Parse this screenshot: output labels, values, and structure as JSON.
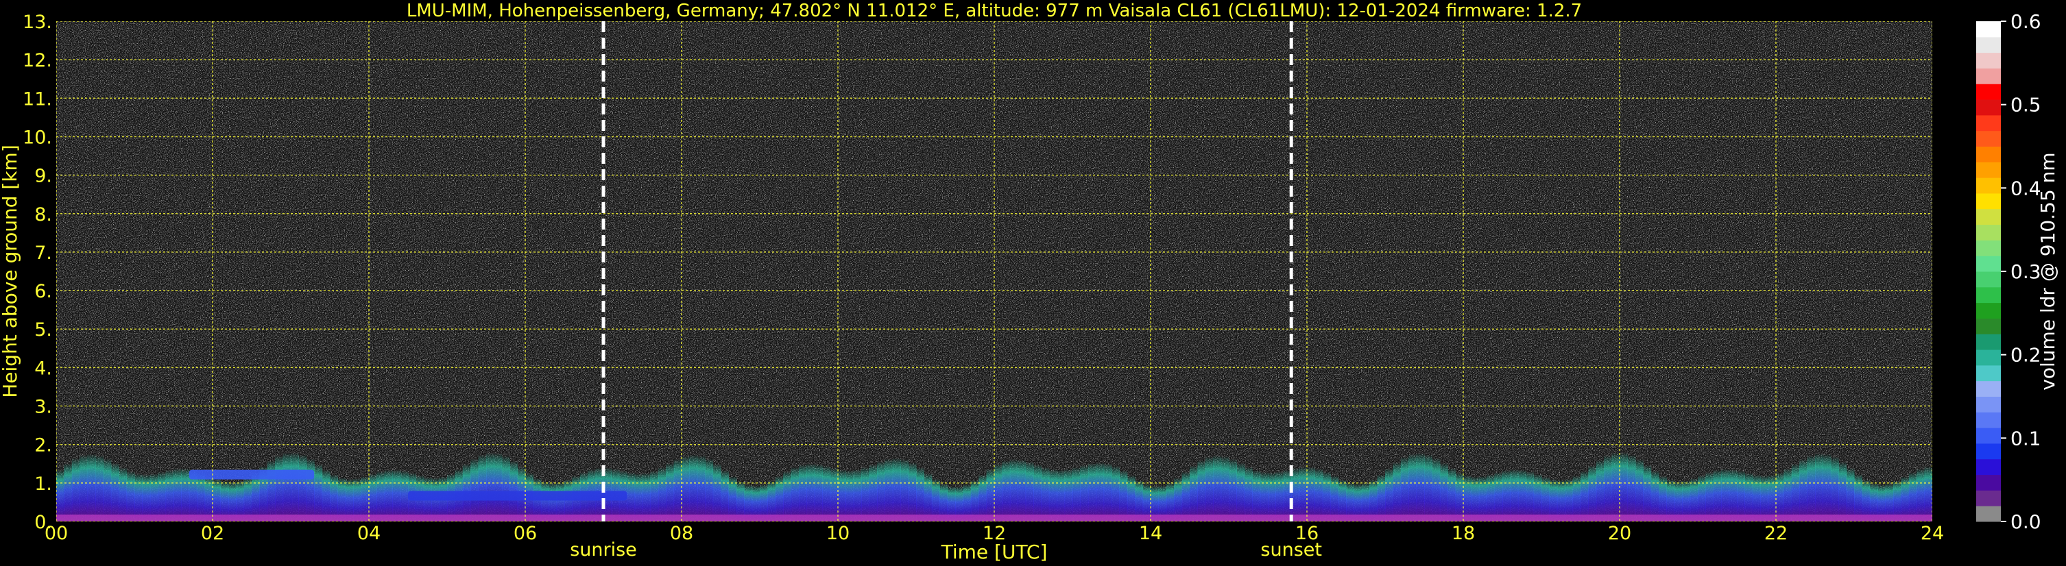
{
  "chart_data": {
    "type": "heatmap",
    "title": "LMU-MIM, Hohenpeissenberg, Germany; 47.802° N 11.012° E, altitude: 977 m    Vaisala CL61 (CL61LMU): 12-01-2024    firmware: 1.2.7",
    "xlabel": "Time [UTC]",
    "ylabel": "Height above ground [km]",
    "xlim": [
      0,
      24
    ],
    "ylim": [
      0,
      13
    ],
    "x_ticks": [
      "00",
      "02",
      "04",
      "06",
      "08",
      "10",
      "12",
      "14",
      "16",
      "18",
      "20",
      "22",
      "24"
    ],
    "y_ticks": [
      "0.",
      "1.",
      "2.",
      "3.",
      "4.",
      "5.",
      "6.",
      "7.",
      "8.",
      "9.",
      "10.",
      "11.",
      "12.",
      "13."
    ],
    "grid": true,
    "sun_events": [
      {
        "label": "sunrise",
        "time_h": 7.0
      },
      {
        "label": "sunset",
        "time_h": 15.8
      }
    ],
    "colorbar": {
      "label": "volume ldr @ 910.55 nm",
      "range": [
        0.0,
        0.6
      ],
      "ticks": [
        "0.0",
        "0.1",
        "0.2",
        "0.3",
        "0.4",
        "0.5",
        "0.6"
      ],
      "colors": [
        "#8a8a8a",
        "#6a2b8f",
        "#4a0aa0",
        "#2a10d8",
        "#1a3af0",
        "#3a5cf5",
        "#5a78f5",
        "#7a94f5",
        "#9ab0f5",
        "#4ec9c8",
        "#2ab39a",
        "#1a9a70",
        "#2a8a2a",
        "#1fa01f",
        "#2ec04a",
        "#48d070",
        "#60e090",
        "#82e07a",
        "#a8e060",
        "#d0e040",
        "#ffe000",
        "#ffc000",
        "#ffa000",
        "#ff8000",
        "#ff5a1a",
        "#ff3a1a",
        "#e01010",
        "#ff0000",
        "#f0a0a0",
        "#f0c8c8",
        "#e8e8e8",
        "#ffffff"
      ]
    },
    "layers": [
      {
        "name": "noise",
        "description_value": "random ldr 0.0-0.6 above ~1.5 km"
      },
      {
        "name": "boundary_layer",
        "t_start": 0,
        "t_end": 24,
        "top_km_typical": 1.8
      }
    ],
    "cloud_features": [
      {
        "t_start": 1.7,
        "t_end": 3.3,
        "height_km": 1.2,
        "ldr": 0.1
      },
      {
        "t_start": 4.5,
        "t_end": 7.3,
        "height_km": 0.65,
        "ldr": 0.05
      }
    ]
  }
}
